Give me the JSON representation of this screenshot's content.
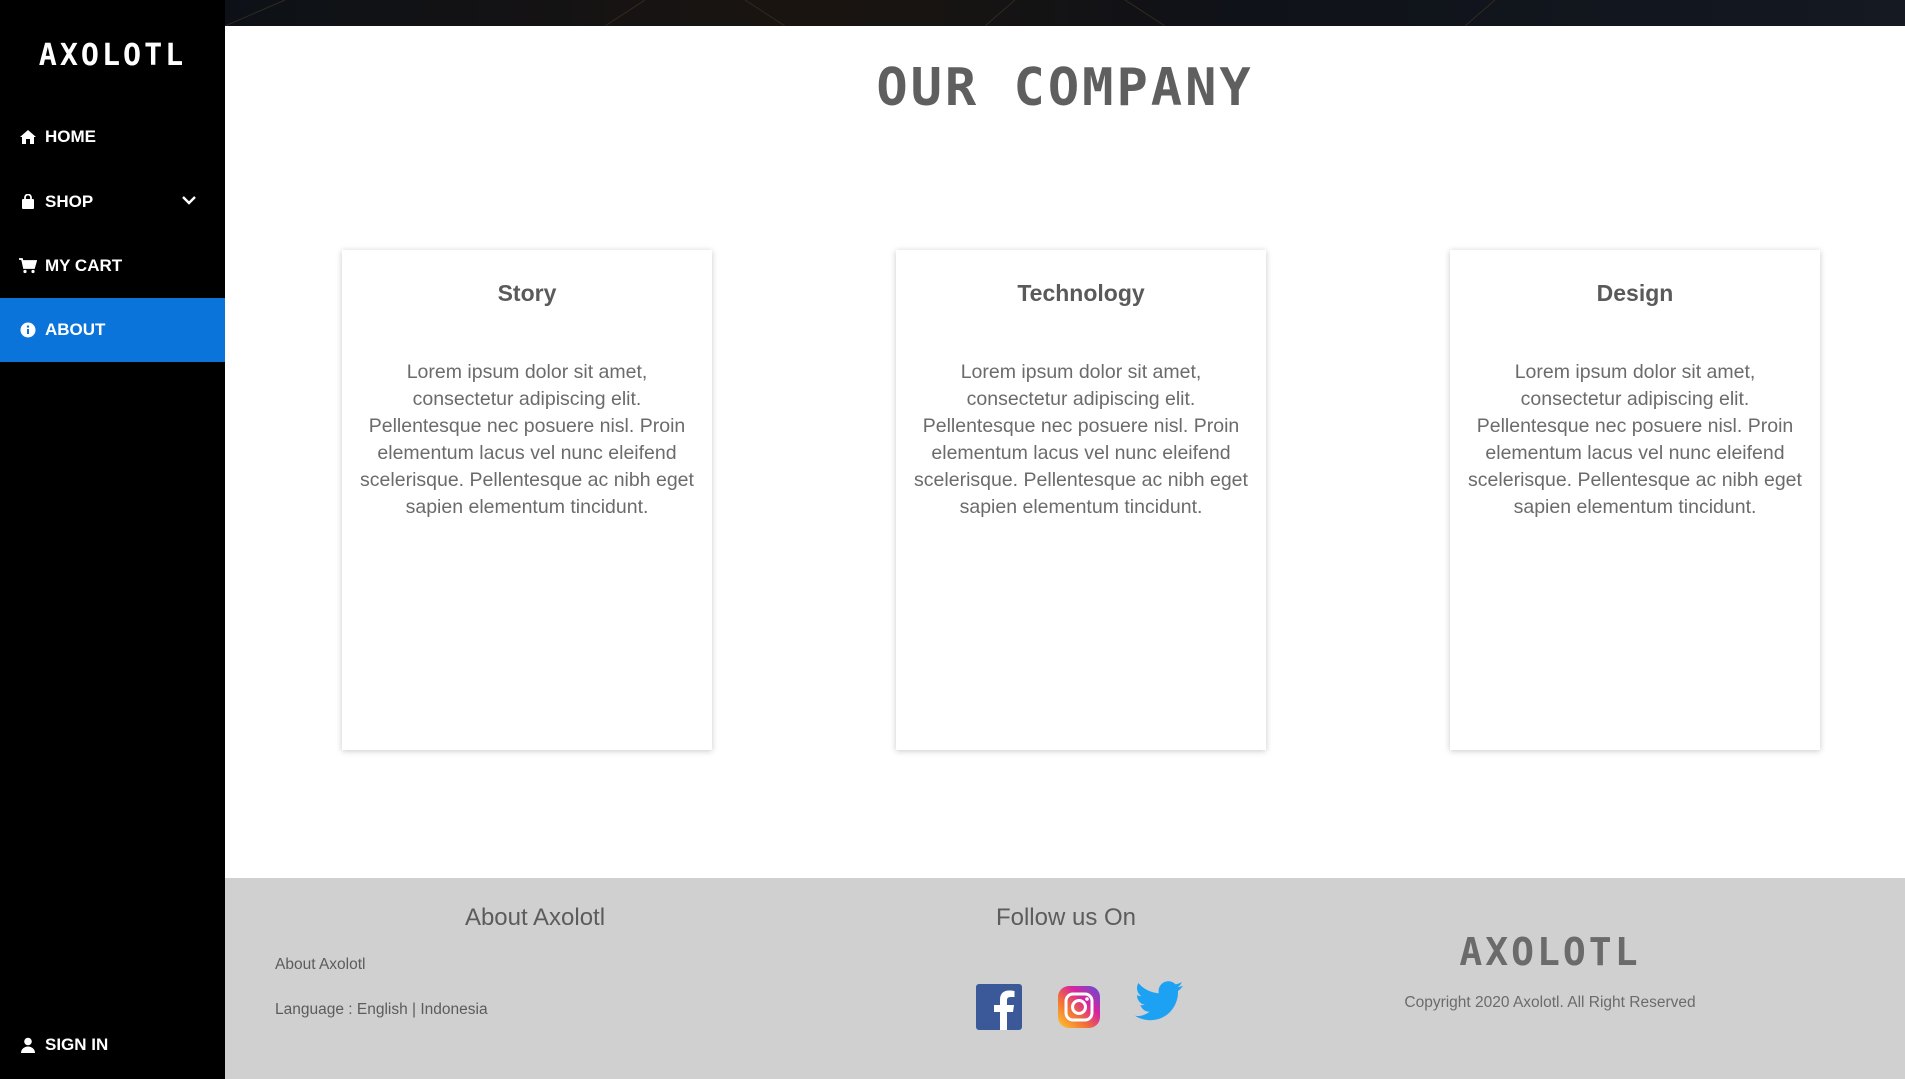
{
  "sidebar": {
    "logo": "AXOLOTL",
    "items": [
      {
        "label": "HOME",
        "icon": "home-icon"
      },
      {
        "label": "SHOP",
        "icon": "shopping-bag-icon"
      },
      {
        "label": "MY CART",
        "icon": "cart-icon"
      },
      {
        "label": "ABOUT",
        "icon": "info-icon"
      }
    ],
    "active_item": "ABOUT",
    "sign_in": "SIGN IN"
  },
  "main": {
    "title": "OUR COMPANY",
    "cards": [
      {
        "title": "Story",
        "text": "Lorem ipsum dolor sit amet, consectetur adipiscing elit. Pellentesque nec posuere nisl. Proin elementum lacus vel nunc eleifend scelerisque. Pellentesque ac nibh eget sapien elementum tincidunt."
      },
      {
        "title": "Technology",
        "text": "Lorem ipsum dolor sit amet, consectetur adipiscing elit. Pellentesque nec posuere nisl. Proin elementum lacus vel nunc eleifend scelerisque. Pellentesque ac nibh eget sapien elementum tincidunt."
      },
      {
        "title": "Design",
        "text": "Lorem ipsum dolor sit amet, consectetur adipiscing elit. Pellentesque nec posuere nisl. Proin elementum lacus vel nunc eleifend scelerisque. Pellentesque ac nibh eget sapien elementum tincidunt."
      }
    ]
  },
  "footer": {
    "about_heading": "About Axolotl",
    "about_link": "About Axolotl",
    "language_label": "Language : ",
    "language_english": "English",
    "language_sep": " | ",
    "language_indonesia": "Indonesia",
    "follow_heading": "Follow us On",
    "social_icons": [
      "facebook-icon",
      "instagram-icon",
      "twitter-icon"
    ],
    "logo": "AXOLOTL",
    "copyright": "Copyright 2020 Axolotl. All Right Reserved"
  },
  "colors": {
    "sidebar_bg": "#000000",
    "active_bg": "#0a74da",
    "footer_bg": "#d0d0d0",
    "facebook": "#3b5998",
    "twitter": "#1da1f2"
  }
}
